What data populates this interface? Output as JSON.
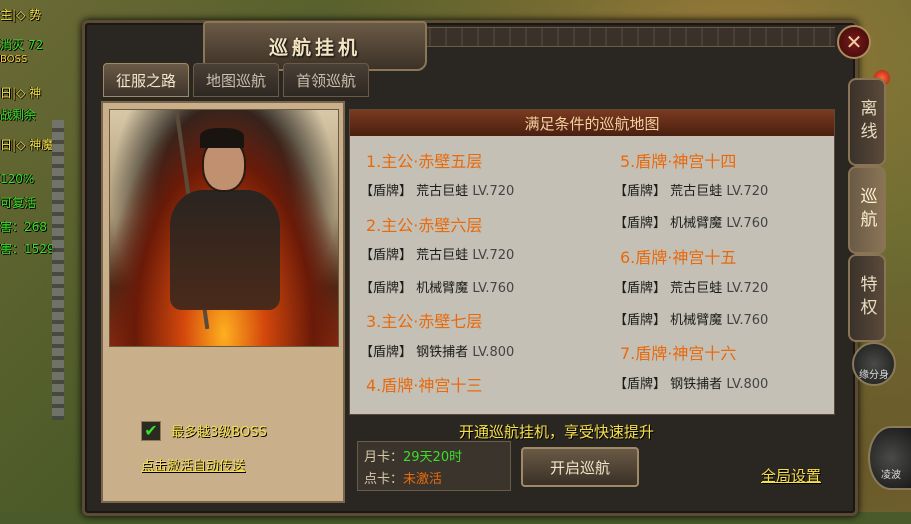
{
  "hud": {
    "lines": [
      {
        "text": "主|◇ 势",
        "color": "#f6e04a"
      },
      {
        "text": "消灭 72",
        "color": "#3adf2a"
      },
      {
        "text": "BOSS",
        "color": "#ffd23c"
      },
      {
        "text": "日|◇ 神",
        "color": "#f6e04a"
      },
      {
        "text": "战剩余",
        "color": "#3adf2a"
      },
      {
        "text": "日|◇ 神魔",
        "color": "#f6e04a"
      },
      {
        "text": "120%",
        "color": "#3adf2a"
      },
      {
        "text": "可复活",
        "color": "#3adf2a"
      },
      {
        "text": "害：268",
        "color": "#3adf2a"
      },
      {
        "text": "害：1529",
        "color": "#3adf2a"
      }
    ]
  },
  "dialog": {
    "title": "巡航挂机",
    "close_label": "✕",
    "tabs": [
      {
        "label": "征服之路",
        "active": true
      },
      {
        "label": "地图巡航",
        "active": false
      },
      {
        "label": "首领巡航",
        "active": false
      }
    ],
    "left": {
      "checkbox_label": "最多越3级BOSS",
      "checked_mark": "✔",
      "activate_link": "点击激活自动传送"
    },
    "list_header": "满足条件的巡航地图",
    "maps_left": [
      {
        "title": "1.主公·赤壁五层",
        "monsters": [
          {
            "tag": "【盾牌】",
            "name": "荒古巨蛙",
            "lv": "LV.720"
          }
        ]
      },
      {
        "title": "2.主公·赤壁六层",
        "monsters": [
          {
            "tag": "【盾牌】",
            "name": "荒古巨蛙",
            "lv": "LV.720"
          },
          {
            "tag": "【盾牌】",
            "name": "机械臂魔",
            "lv": "LV.760"
          }
        ]
      },
      {
        "title": "3.主公·赤壁七层",
        "monsters": [
          {
            "tag": "【盾牌】",
            "name": "钢铁捕者",
            "lv": "LV.800"
          }
        ]
      },
      {
        "title": "4.盾牌·神宫十三",
        "monsters": []
      }
    ],
    "maps_right": [
      {
        "title": "5.盾牌·神宫十四",
        "monsters": [
          {
            "tag": "【盾牌】",
            "name": "荒古巨蛙",
            "lv": "LV.720"
          },
          {
            "tag": "【盾牌】",
            "name": "机械臂魔",
            "lv": "LV.760"
          }
        ]
      },
      {
        "title": "6.盾牌·神宫十五",
        "monsters": [
          {
            "tag": "【盾牌】",
            "name": "荒古巨蛙",
            "lv": "LV.720"
          },
          {
            "tag": "【盾牌】",
            "name": "机械臂魔",
            "lv": "LV.760"
          }
        ]
      },
      {
        "title": "7.盾牌·神宫十六",
        "monsters": [
          {
            "tag": "【盾牌】",
            "name": "钢铁捕者",
            "lv": "LV.800"
          }
        ]
      }
    ],
    "promo": "开通巡航挂机，享受快速提升",
    "cards": [
      {
        "key": "月卡：",
        "value": "29天20时",
        "color": "#3adf2a"
      },
      {
        "key": "点卡：",
        "value": "未激活",
        "color": "#e86a0c"
      }
    ],
    "start_button": "开启巡航",
    "global_settings": "全局设置"
  },
  "side_tabs": [
    {
      "label": "离线",
      "active": false
    },
    {
      "label": "巡航",
      "active": true
    },
    {
      "label": "特权",
      "active": false
    }
  ],
  "side_icons": {
    "icon1": "缘分身",
    "icon2": "凌波"
  }
}
